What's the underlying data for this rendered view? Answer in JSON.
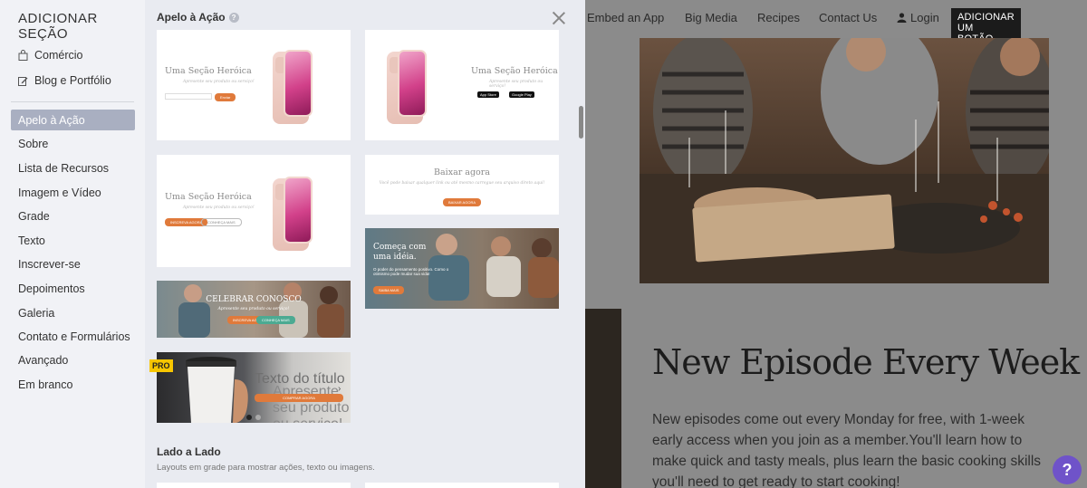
{
  "sidebar": {
    "title": "ADICIONAR SEÇÃO",
    "top_items": [
      {
        "label": "Comércio",
        "icon": "shopping-bag-icon"
      },
      {
        "label": "Blog e Portfólio",
        "icon": "edit-icon"
      }
    ],
    "items": [
      {
        "label": "Apelo à Ação",
        "active": true
      },
      {
        "label": "Sobre"
      },
      {
        "label": "Lista de Recursos"
      },
      {
        "label": "Imagem e Vídeo"
      },
      {
        "label": "Grade"
      },
      {
        "label": "Texto"
      },
      {
        "label": "Inscrever-se"
      },
      {
        "label": "Depoimentos"
      },
      {
        "label": "Galeria"
      },
      {
        "label": "Contato e Formulários"
      },
      {
        "label": "Avançado"
      },
      {
        "label": "Em branco"
      }
    ]
  },
  "gallery": {
    "section_title": "Apelo à Ação",
    "help_icon": "question-icon",
    "close_icon": "close-icon",
    "cards": {
      "hero1": {
        "title": "Uma Seção Heróica",
        "sub": "Apresente seu produto ou serviço!",
        "button": "Enviar"
      },
      "hero2": {
        "title": "Uma Seção Heróica",
        "sub": "Apresente seu produto ou serviço!",
        "badge_a": "App Store",
        "badge_b": "Google Play"
      },
      "hero3": {
        "title": "Uma Seção Heróica",
        "sub": "Apresente seu produto ou serviço!",
        "btn_primary": "INSCREVA AGORA",
        "btn_secondary": "CONHEÇA MAIS"
      },
      "download": {
        "title": "Baixar agora",
        "sub": "Você pode baixar qualquer link ou até mesmo carregue seu arquivo direto aqui!",
        "button": "BAIXAR AGORA"
      },
      "idea": {
        "title": "Começa com uma idéia.",
        "sub": "O poder do pensamento positivo. Como o otimismo pode mudar sua vida!",
        "button": "SAIBA MAIS"
      },
      "celebrate": {
        "title": "CELEBRAR CONOSCO",
        "sub": "Apresente seu produto ou serviço!",
        "btn_primary": "INSCREVA AGORA",
        "btn_secondary": "CONHEÇA MAIS"
      },
      "coffee": {
        "title": "Texto do título",
        "sub": "Apresente seu produto ou serviço!",
        "button": "COMPRAR AGORA",
        "badge": "PRO"
      }
    },
    "section2_title": "Lado a Lado",
    "section2_sub": "Layouts em grade para mostrar ações, texto ou imagens."
  },
  "site": {
    "nav": [
      "Embed an App",
      "Big Media",
      "Recipes",
      "Contact Us"
    ],
    "login": "Login",
    "cta": "ADICIONAR UM BOTÃO.",
    "heading": "New Episode Every Week",
    "body": "New episodes come out every Monday for free, with 1-week early access when you join as a member.You'll learn how to make quick and tasty meals, plus learn the basic cooking skills you'll need to get ready to start cooking!",
    "help_label": "?"
  },
  "colors": {
    "accent": "#e07a3b",
    "active_category": "#a9afc1",
    "help": "#6f53c9",
    "pro": "#f7c600"
  }
}
